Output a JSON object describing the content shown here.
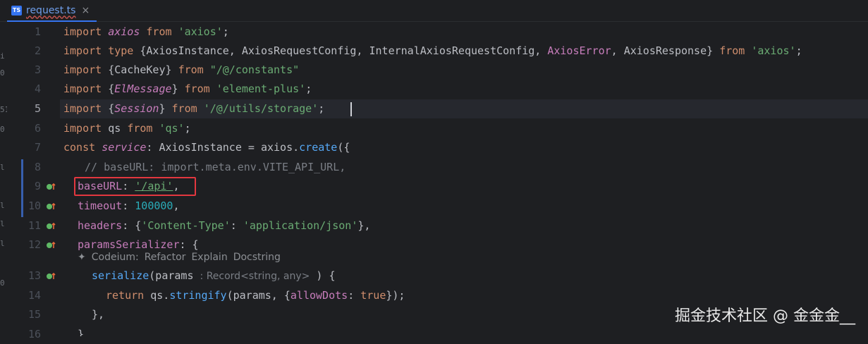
{
  "tab": {
    "icon_label": "TS",
    "label": "request.ts",
    "close": "×"
  },
  "left_strip": [
    "i",
    "0",
    "51",
    "0",
    "l",
    "l",
    "l",
    "l",
    "0"
  ],
  "gutter": {
    "line_numbers": [
      "1",
      "2",
      "3",
      "4",
      "5",
      "6",
      "7",
      "8",
      "9",
      "10",
      "11",
      "12",
      "13",
      "14",
      "15",
      "16"
    ],
    "active_line": "5"
  },
  "code": {
    "l1": [
      "import",
      " ",
      "axios",
      " ",
      "from",
      " ",
      "'axios'",
      ";"
    ],
    "l2": [
      "import",
      " ",
      "type",
      " {AxiosInstance, AxiosRequestConfig, InternalAxiosRequestConfig, ",
      "AxiosError",
      ", AxiosResponse} ",
      "from",
      " ",
      "'axios'",
      ";"
    ],
    "l3": [
      "import",
      " {CacheKey} ",
      "from",
      " ",
      "\"/@/constants\""
    ],
    "l4": [
      "import",
      " {",
      "ElMessage",
      "} ",
      "from",
      " ",
      "'element-plus'",
      ";"
    ],
    "l5": [
      "import",
      " {",
      "Session",
      "} ",
      "from",
      " ",
      "'/@/utils/storage'",
      ";"
    ],
    "l6": [
      "import",
      " qs ",
      "from",
      " ",
      "'qs'",
      ";"
    ],
    "l7": [
      "const",
      " ",
      "service",
      ": AxiosInstance = axios.",
      "create",
      "({"
    ],
    "l8": "// baseURL: import.meta.env.VITE_API_URL,",
    "l9": [
      "baseURL",
      ": ",
      "'/api'",
      ","
    ],
    "l10": [
      "timeout",
      ": ",
      "100000",
      ","
    ],
    "l11": [
      "headers",
      ": {",
      "'Content-Type'",
      ": ",
      "'application/json'",
      "},"
    ],
    "l12": [
      "paramsSerializer",
      ": {"
    ],
    "l13": [
      "serialize",
      "(params ",
      ": Record<string, any>",
      " ) {"
    ],
    "l14": [
      "return",
      " qs.",
      "stringify",
      "(params, {",
      "allowDots",
      ": ",
      "true",
      "});"
    ],
    "l15": "},",
    "l16": "}"
  },
  "codelens": {
    "provider": "Codeium:",
    "actions": [
      "Refactor",
      "Explain",
      "Docstring"
    ]
  },
  "watermark": "掘金技术社区 @ 金金金__",
  "colors": {
    "keyword": "#cf8e6d",
    "string": "#6aab73",
    "property": "#c77dbb",
    "function": "#56a8f5",
    "number": "#2aacb8",
    "highlight_box": "#e3373f"
  }
}
